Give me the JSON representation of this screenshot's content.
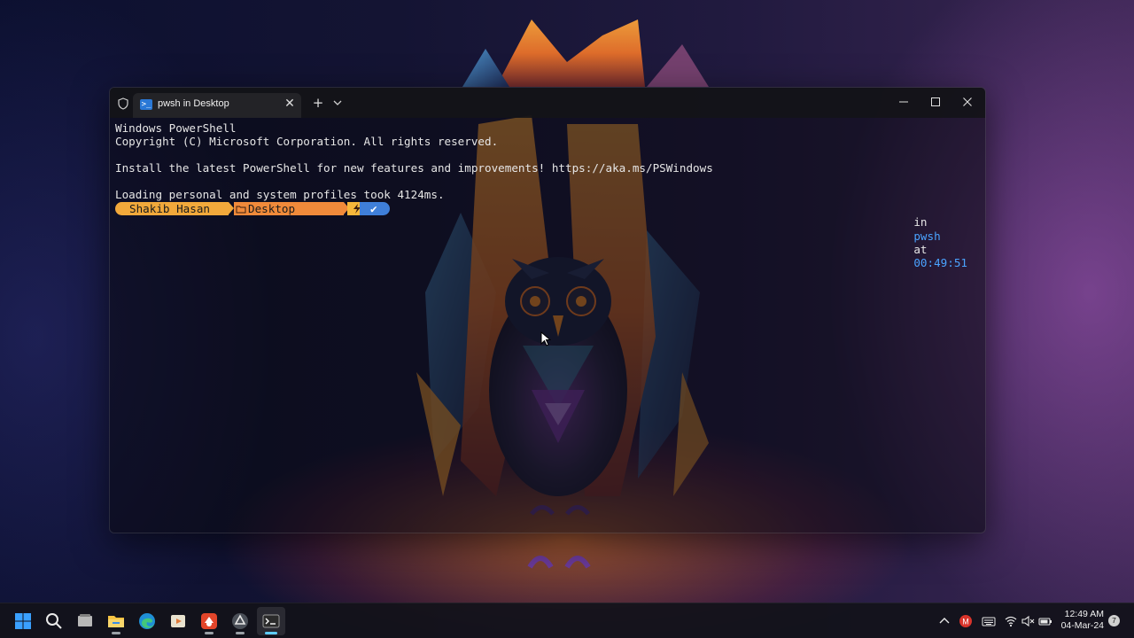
{
  "window": {
    "tab_title": "pwsh in Desktop",
    "new_tab_symbol": "+",
    "close_symbol": "✕"
  },
  "terminal": {
    "lines": [
      "Windows PowerShell",
      "Copyright (C) Microsoft Corporation. All rights reserved.",
      "",
      "Install the latest PowerShell for new features and improvements! https://aka.ms/PSWindows",
      "",
      "Loading personal and system profiles took 4124ms."
    ],
    "prompt": {
      "user": "Shakib Hasan",
      "path": "Desktop",
      "status_symbol": "✔"
    },
    "right_prompt": {
      "in_word": "in",
      "shell": "pwsh",
      "at_word": "at",
      "time": "00:49:51"
    }
  },
  "taskbar": {
    "apps": [
      {
        "name": "start-button",
        "icon": "windows-logo-icon"
      },
      {
        "name": "search-button",
        "icon": "search-icon"
      },
      {
        "name": "task-view-button",
        "icon": "task-view-icon"
      },
      {
        "name": "file-explorer-button",
        "icon": "folder-icon"
      },
      {
        "name": "edge-button",
        "icon": "edge-icon"
      },
      {
        "name": "media-player-button",
        "icon": "media-player-icon"
      },
      {
        "name": "red-app-button",
        "icon": "red-app-icon"
      },
      {
        "name": "chatgpt-button",
        "icon": "openai-icon"
      },
      {
        "name": "terminal-button",
        "icon": "terminal-icon"
      }
    ],
    "clock_time": "12:49 AM",
    "clock_date": "04-Mar-24",
    "notification_count": "7"
  },
  "colors": {
    "prompt_user_bg": "#f2a93b",
    "prompt_path_bg": "#f08a3a",
    "prompt_git_bg": "#f6b73a",
    "prompt_status_bg": "#3f7fd9",
    "accent_blue": "#4aa3ff"
  }
}
